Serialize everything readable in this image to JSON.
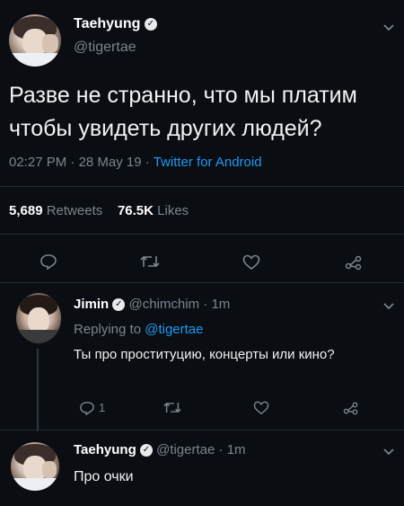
{
  "main_tweet": {
    "display_name": "Taehyung",
    "handle": "@tigertae",
    "text_line1": "Разве не странно, что мы платим",
    "text_line2": "чтобы увидеть других людей?",
    "time": "02:27 PM",
    "date": "28 May 19",
    "separator": "·",
    "source": "Twitter for Android",
    "retweets_count": "5,689",
    "retweets_label": "Retweets",
    "likes_count": "76.5K",
    "likes_label": "Likes"
  },
  "reply1": {
    "display_name": "Jimin",
    "handle": "@chimchim",
    "time": "1m",
    "separator": "·",
    "replying_prefix": "Replying to",
    "replying_handle": "@tigertae",
    "text": "Ты про проституцию, концерты или кино?",
    "reply_count": "1"
  },
  "reply2": {
    "display_name": "Taehyung",
    "handle": "@tigertae",
    "time": "1m",
    "separator": "·",
    "text": "Про очки"
  },
  "icons": {
    "verified": "verified-badge-icon",
    "chevron": "chevron-down-icon",
    "reply": "reply-icon",
    "retweet": "retweet-icon",
    "like": "heart-icon",
    "share": "share-icon"
  },
  "colors": {
    "background": "#0a0d12",
    "text": "#e7e9ea",
    "muted": "#7b8590",
    "link": "#1d9bf0"
  }
}
